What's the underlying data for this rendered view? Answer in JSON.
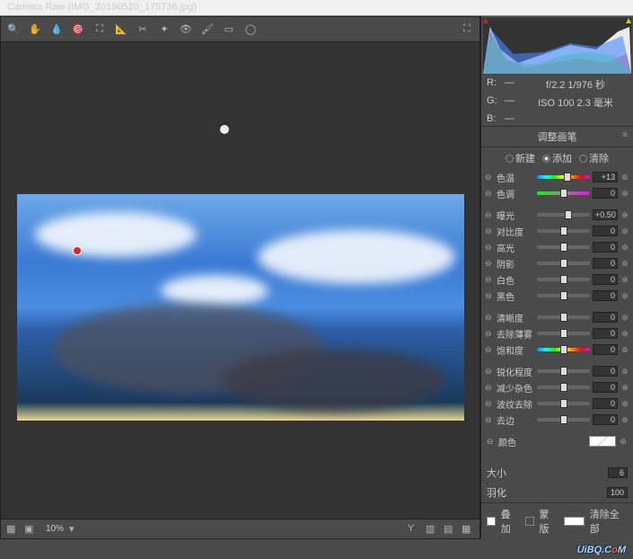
{
  "window": {
    "title": "Camera Raw (IMG_20190520_175736.jpg)"
  },
  "toolbar": {
    "icons": [
      "zoom-icon",
      "hand-icon",
      "eyedropper-icon",
      "color-sampler-icon",
      "crop-icon",
      "straighten-icon",
      "transform-icon",
      "spot-removal-icon",
      "redeye-icon",
      "adjustment-brush-icon",
      "graduated-filter-icon",
      "radial-filter-icon",
      "rotate-icon"
    ],
    "fullscreen": "⛶"
  },
  "info": {
    "r_label": "R:",
    "g_label": "G:",
    "b_label": "B:",
    "r": "—",
    "g": "—",
    "b": "—",
    "exposure": "f/2.2  1/976 秒",
    "iso": "ISO 100  2.3 毫米"
  },
  "panel": {
    "title": "调整画笔",
    "modes": {
      "new": "新建",
      "add": "添加",
      "erase": "清除",
      "active": "add"
    }
  },
  "sliders": [
    {
      "key": "temp",
      "label": "色温",
      "value": "+13",
      "pos": 58,
      "track": "rainbow"
    },
    {
      "key": "tint",
      "label": "色调",
      "value": "0",
      "pos": 50,
      "track": "tint"
    },
    {
      "gap": true
    },
    {
      "key": "exposure",
      "label": "曝光",
      "value": "+0.50",
      "pos": 60
    },
    {
      "key": "contrast",
      "label": "对比度",
      "value": "0",
      "pos": 50
    },
    {
      "key": "highlights",
      "label": "高光",
      "value": "0",
      "pos": 50
    },
    {
      "key": "shadows",
      "label": "阴影",
      "value": "0",
      "pos": 50
    },
    {
      "key": "whites",
      "label": "白色",
      "value": "0",
      "pos": 50
    },
    {
      "key": "blacks",
      "label": "黑色",
      "value": "0",
      "pos": 50
    },
    {
      "gap": true
    },
    {
      "key": "clarity",
      "label": "清晰度",
      "value": "0",
      "pos": 50
    },
    {
      "key": "dehaze",
      "label": "去除薄雾",
      "value": "0",
      "pos": 50
    },
    {
      "key": "saturation",
      "label": "饱和度",
      "value": "0",
      "pos": 50,
      "track": "rainbow"
    },
    {
      "gap": true
    },
    {
      "key": "sharpness",
      "label": "锐化程度",
      "value": "0",
      "pos": 50
    },
    {
      "key": "noise",
      "label": "减少杂色",
      "value": "0",
      "pos": 50
    },
    {
      "key": "moire",
      "label": "波纹去除",
      "value": "0",
      "pos": 50
    },
    {
      "key": "defringe",
      "label": "去边",
      "value": "0",
      "pos": 50
    }
  ],
  "color_row": {
    "label": "颜色"
  },
  "brush": {
    "size_label": "大小",
    "size": "6",
    "feather_label": "羽化",
    "feather": "100"
  },
  "footer": {
    "overlay": "叠加",
    "overlay_on": true,
    "mask": "蒙版",
    "mask_on": false,
    "clear": "清除全部"
  },
  "bottom": {
    "zoom": "10%",
    "views": "Y"
  },
  "watermark": {
    "text": "UiBQ.C",
    "o": "o",
    "m": "M"
  }
}
